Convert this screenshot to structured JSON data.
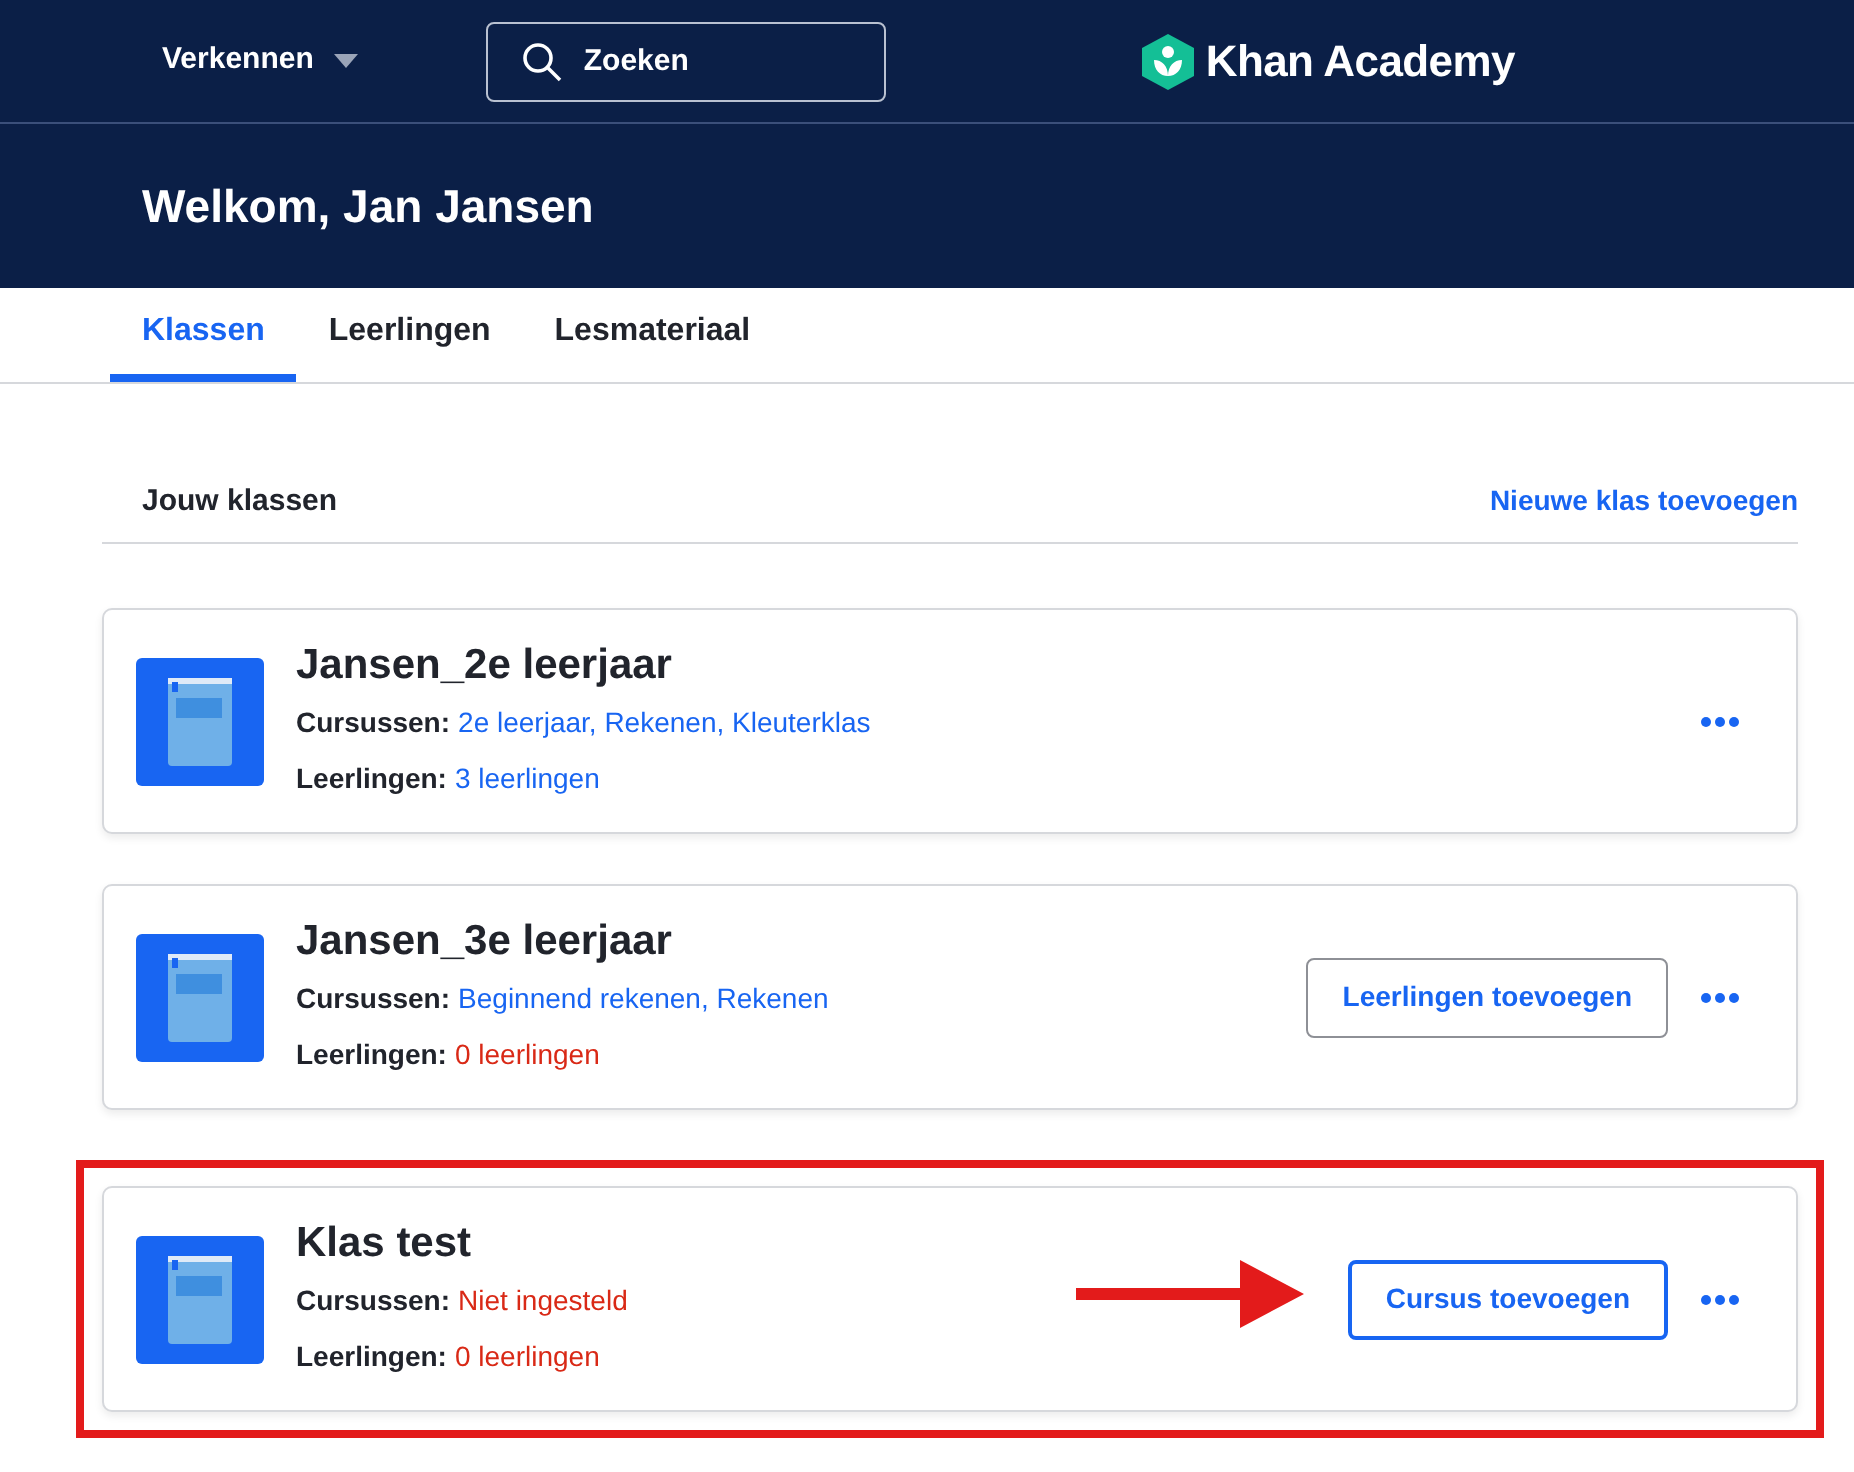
{
  "nav": {
    "explore": "Verkennen",
    "search_placeholder": "Zoeken",
    "logo": "Khan Academy"
  },
  "welcome": "Welkom, Jan Jansen",
  "tabs": [
    {
      "label": "Klassen",
      "selected": true
    },
    {
      "label": "Leerlingen",
      "selected": false
    },
    {
      "label": "Lesmateriaal",
      "selected": false
    }
  ],
  "section": {
    "title": "Jouw klassen",
    "add_link": "Nieuwe klas toevoegen"
  },
  "classes": [
    {
      "name": "Jansen_2e leerjaar",
      "courses_label": "Cursussen:",
      "courses": "2e leerjaar, Rekenen, Kleuterklas",
      "courses_missing": false,
      "students_label": "Leerlingen:",
      "students": "3 leerlingen",
      "students_missing": false,
      "highlighted": false
    },
    {
      "name": "Jansen_3e leerjaar",
      "courses_label": "Cursussen:",
      "courses": "Beginnend rekenen, Rekenen",
      "courses_missing": false,
      "students_label": "Leerlingen:",
      "students": "0 leerlingen",
      "students_missing": true,
      "action": {
        "label": "Leerlingen toevoegen",
        "kind": "secondary"
      },
      "highlighted": false
    },
    {
      "name": "Klas test",
      "courses_label": "Cursussen:",
      "courses": "Niet ingesteld",
      "courses_missing": true,
      "students_label": "Leerlingen:",
      "students": "0 leerlingen",
      "students_missing": true,
      "action": {
        "label": "Cursus toevoegen",
        "kind": "primary"
      },
      "highlighted": true
    }
  ]
}
